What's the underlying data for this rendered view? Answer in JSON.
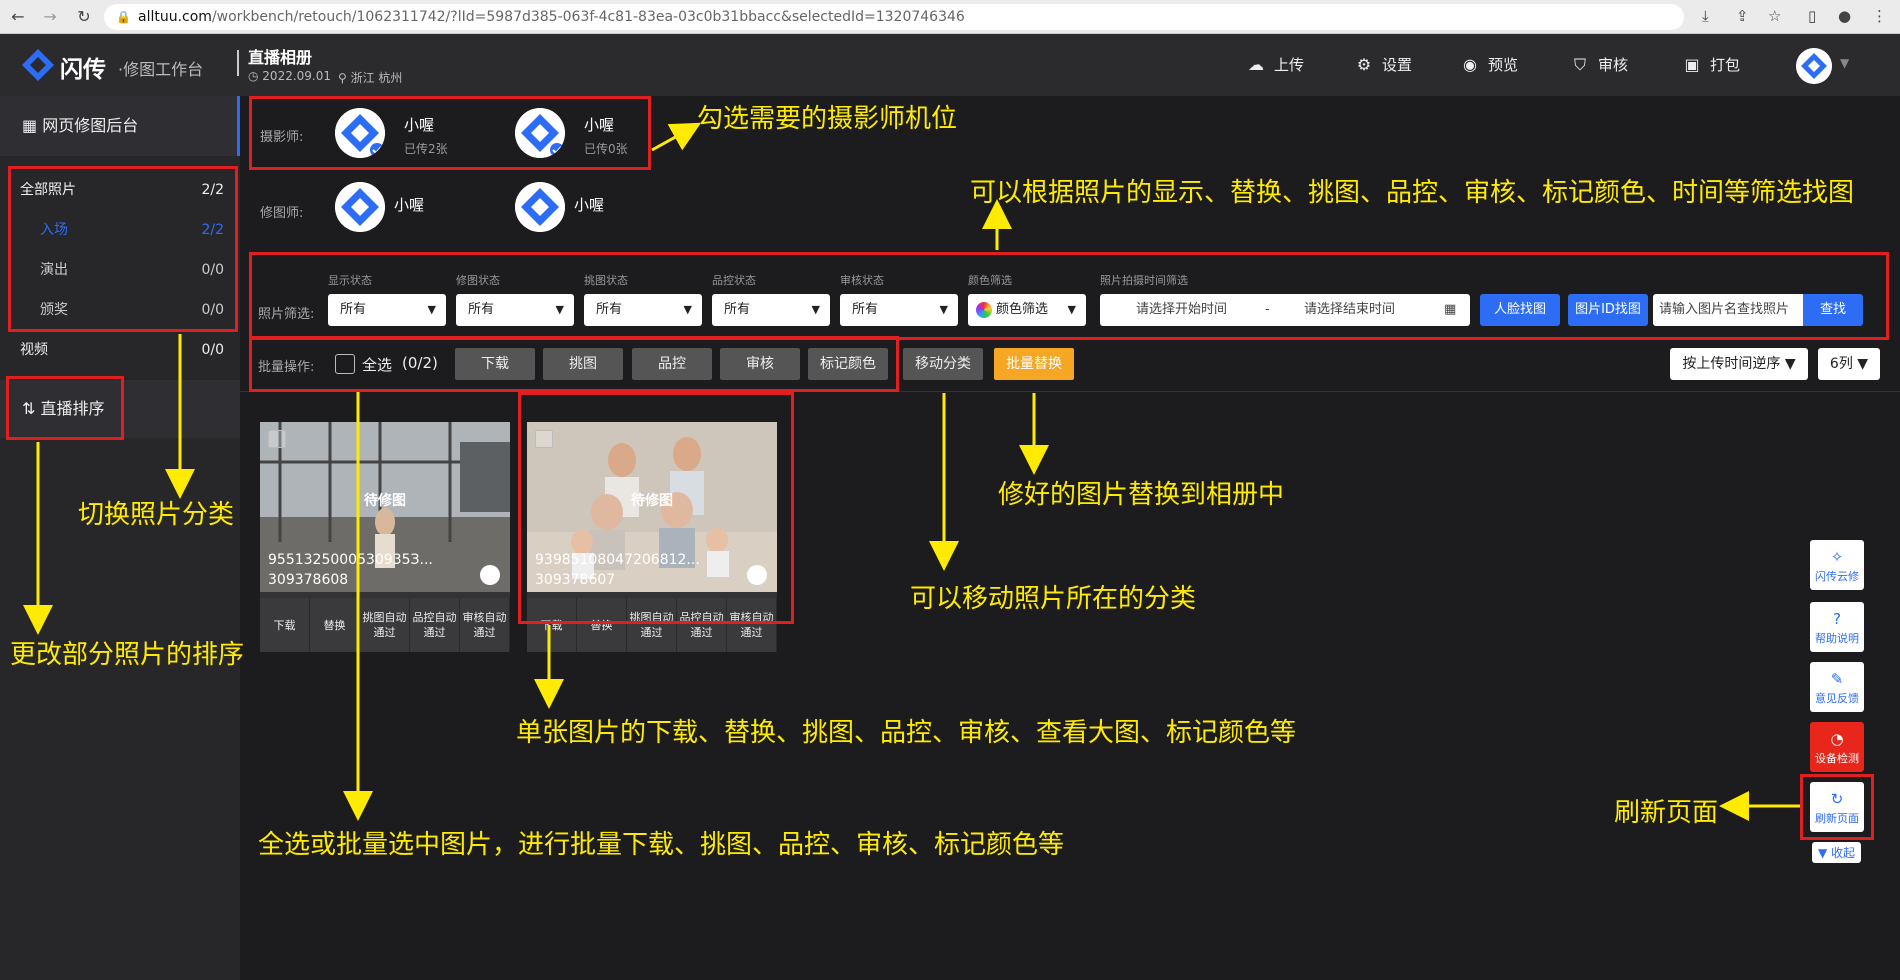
{
  "browser": {
    "url_host": "alltuu.com",
    "url_path": "/workbench/retouch/1062311742/?lId=5987d385-063f-4c81-83ea-03c0b31bbacc&selectedId=1320746346"
  },
  "app": {
    "logo_text": "闪传",
    "logo_sub": "·修图工作台",
    "album_title": "直播相册",
    "album_date": "2022.09.01",
    "album_location": "浙江 杭州",
    "toolbar": {
      "upload": "上传",
      "settings": "设置",
      "preview": "预览",
      "review": "审核",
      "pack": "打包"
    }
  },
  "sidebar": {
    "header": "网页修图后台",
    "items": [
      {
        "label": "全部照片",
        "count": "2/2"
      },
      {
        "label": "入场",
        "count": "2/2"
      },
      {
        "label": "演出",
        "count": "0/0"
      },
      {
        "label": "颁奖",
        "count": "0/0"
      },
      {
        "label": "视频",
        "count": "0/0"
      }
    ],
    "sort_label": "直播排序"
  },
  "photographers": {
    "label": "摄影师:",
    "list": [
      {
        "name": "小喔",
        "sub": "已传2张"
      },
      {
        "name": "小喔",
        "sub": "已传0张"
      }
    ]
  },
  "retouchers": {
    "label": "修图师:",
    "list": [
      {
        "name": "小喔"
      },
      {
        "name": "小喔"
      }
    ]
  },
  "filters": {
    "row_label": "照片筛选:",
    "groups": [
      {
        "label": "显示状态",
        "value": "所有"
      },
      {
        "label": "修图状态",
        "value": "所有"
      },
      {
        "label": "挑图状态",
        "value": "所有"
      },
      {
        "label": "品控状态",
        "value": "所有"
      },
      {
        "label": "审核状态",
        "value": "所有"
      },
      {
        "label": "颜色筛选",
        "value": "颜色筛选"
      }
    ],
    "time_label": "照片拍摄时间筛选",
    "start_placeholder": "请选择开始时间",
    "dash": "-",
    "end_placeholder": "请选择结束时间",
    "face_btn": "人脸找图",
    "id_btn": "图片ID找图",
    "search_placeholder": "请输入图片名查找照片",
    "search_btn": "查找"
  },
  "batch": {
    "label": "批量操作:",
    "select_all": "全选",
    "count": "(0/2)",
    "download": "下载",
    "pick": "挑图",
    "qc": "品控",
    "review": "审核",
    "mark_color": "标记颜色",
    "move": "移动分类",
    "replace": "批量替换",
    "sort": "按上传时间逆序",
    "columns": "6列"
  },
  "cards": [
    {
      "status": "待修图",
      "name": "9551325000530935З...",
      "num": "309378608"
    },
    {
      "status": "待修图",
      "name": "93985108047206812...",
      "num": "309378607"
    }
  ],
  "card_actions": [
    "下载",
    "替换",
    "挑图自动通过",
    "品控自动通过",
    "审核自动通过"
  ],
  "float_buttons": [
    "闪传云修",
    "帮助说明",
    "意见反馈",
    "设备检测",
    "刷新页面"
  ],
  "collapse": "收起",
  "annotations": {
    "a1": "勾选需要的摄影师机位",
    "a2": "可以根据照片的显示、替换、挑图、品控、审核、标记颜色、时间等筛选找图",
    "a3": "切换照片分类",
    "a4": "修好的图片替换到相册中",
    "a5": "可以移动照片所在的分类",
    "a6": "更改部分照片的排序",
    "a7": "单张图片的下载、替换、挑图、品控、审核、查看大图、标记颜色等",
    "a8": "全选或批量选中图片，进行批量下载、挑图、品控、审核、标记颜色等",
    "a9": "刷新页面"
  },
  "colors": {
    "accent": "#2d6df6",
    "annotation": "#ffeb00",
    "highlight": "#e02020",
    "replace_btn": "#f5a623",
    "device_btn": "#e8261b"
  }
}
